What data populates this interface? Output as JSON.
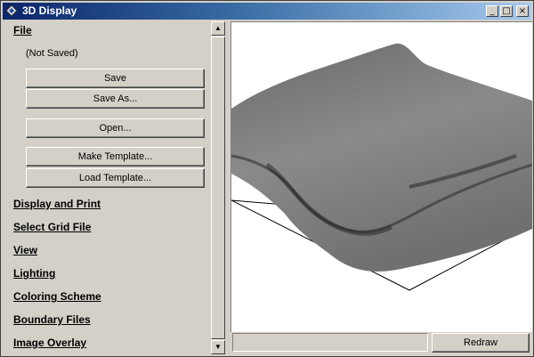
{
  "window": {
    "title": "3D Display",
    "controls": {
      "minimize": "_",
      "maximize": "□",
      "close": "×"
    }
  },
  "panel": {
    "sections": {
      "file": "File",
      "display_print": "Display and Print",
      "select_grid": "Select Grid File",
      "view": "View",
      "lighting": "Lighting",
      "coloring": "Coloring Scheme",
      "boundary": "Boundary Files",
      "overlay": "Image Overlay"
    },
    "save_status": "(Not Saved)",
    "buttons": {
      "save": "Save",
      "save_as": "Save As...",
      "open": "Open...",
      "make_template": "Make Template...",
      "load_template": "Load Template..."
    }
  },
  "footer": {
    "redraw": "Redraw"
  },
  "icons": {
    "app": "app-diamond-icon",
    "scroll_up": "scroll-up-arrow-icon",
    "scroll_down": "scroll-down-arrow-icon"
  },
  "colors": {
    "title_start": "#0a246a",
    "title_end": "#a6caf0",
    "surface": "#d4d0c8"
  }
}
